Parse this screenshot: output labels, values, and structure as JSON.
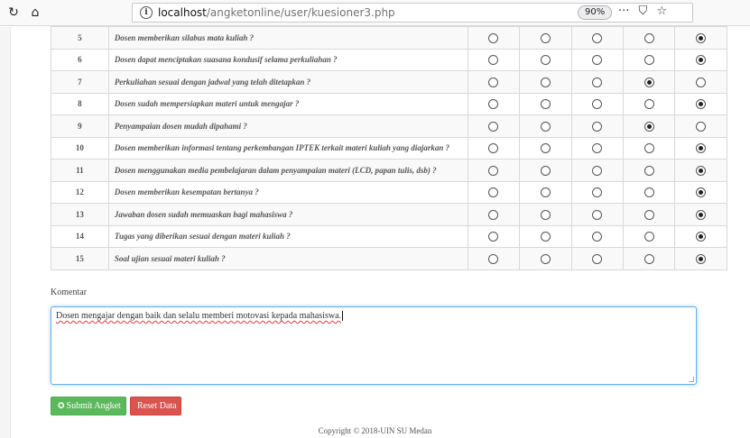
{
  "browser": {
    "reload_icon": "↻",
    "home_icon": "⌂",
    "info_icon": "i",
    "url_host": "localhost",
    "url_path": "/angketonline/user/kuesioner3.php",
    "zoom": "90%",
    "more_icon": "···",
    "pocket_icon": "⛉",
    "bookmark_icon": "☆"
  },
  "questions": [
    {
      "no": "5",
      "text": "Dosen memberikan silabus mata kuliah ?",
      "selected": 5
    },
    {
      "no": "6",
      "text": "Dosen dapat menciptakan suasana kondusif selama perkuliahan ?",
      "selected": 5
    },
    {
      "no": "7",
      "text": "Perkuliahan sesuai dengan jadwal yang telah ditetapkan ?",
      "selected": 4
    },
    {
      "no": "8",
      "text": "Dosen sudah mempersiapkan materi untuk mengajar ?",
      "selected": 5
    },
    {
      "no": "9",
      "text": "Penyampaian dosen mudah dipahami ?",
      "selected": 4
    },
    {
      "no": "10",
      "text": "Dosen memberikan informasi tentang perkembangan IPTEK terkait materi kuliah yang diajarkan ?",
      "selected": 5
    },
    {
      "no": "11",
      "text": "Dosen menggunakan media pembelajaran dalam penyampaian materi (LCD, papan tulis, dsb) ?",
      "selected": 5
    },
    {
      "no": "12",
      "text": "Dosen memberikan kesempatan bertanya ?",
      "selected": 5
    },
    {
      "no": "13",
      "text": "Jawaban dosen sudah memuaskan bagi mahasiswa ?",
      "selected": 5
    },
    {
      "no": "14",
      "text": "Tugas yang diberikan sesuai dengan materi kuliah ?",
      "selected": 5
    },
    {
      "no": "15",
      "text": "Soal ujian sesuai materi kuliah ?",
      "selected": 5
    }
  ],
  "comment": {
    "label": "Komentar",
    "value": "Dosen mengajar dengan baik dan selalu memberi motovasi kepada mahasiswa."
  },
  "buttons": {
    "submit_icon": "✪",
    "submit": "Submit Angket",
    "reset": "Reset Data"
  },
  "footer": {
    "copyright": "Copyright © 2018-UIN SU Medan"
  },
  "colors": {
    "submit": "#5cb85c",
    "reset": "#d9534f",
    "focus": "#66afe9"
  }
}
